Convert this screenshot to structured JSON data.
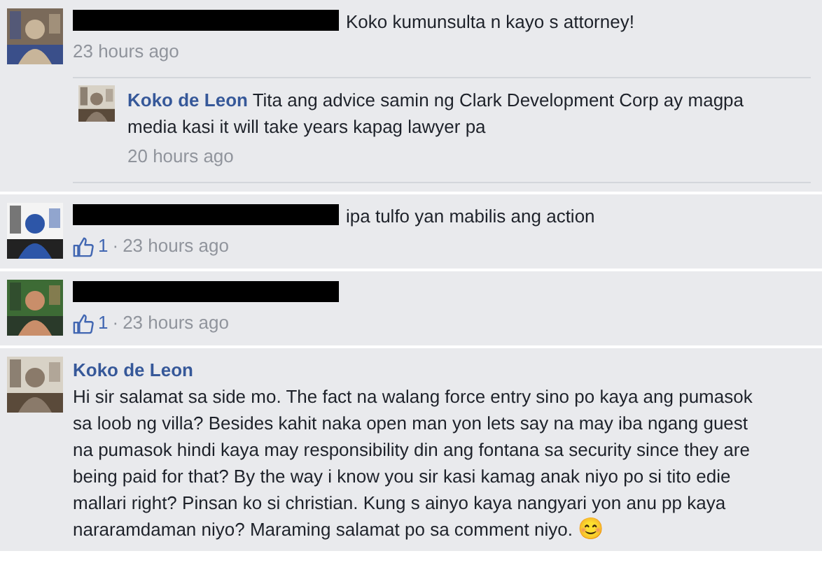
{
  "comments": [
    {
      "redacted": true,
      "text": "Koko kumunsulta n kayo s attorney!",
      "time": "23 hours ago",
      "replies": [
        {
          "author": "Koko de Leon",
          "text": "Tita ang advice samin ng Clark Development Corp ay magpa media kasi it will take years kapag lawyer pa",
          "time": "20 hours ago"
        }
      ]
    },
    {
      "redacted": true,
      "text": "ipa tulfo yan mabilis ang action",
      "likes": "1",
      "separator": "·",
      "time": "23 hours ago"
    },
    {
      "redacted": true,
      "likes": "1",
      "separator": "·",
      "time": "23 hours ago"
    },
    {
      "author": "Koko de Leon",
      "text": "Hi sir salamat sa side mo. The fact na walang force entry sino po kaya ang pumasok sa loob ng villa? Besides kahit naka open man yon lets say na may iba ngang guest na pumasok hindi kaya may responsibility din ang fontana sa security since they are being paid for that? By the way i know you sir kasi kamag anak niyo po si tito edie mallari right? Pinsan ko si christian. Kung s ainyo kaya nangyari yon anu pp kaya nararamdaman niyo? Maraming salamat po sa comment niyo.",
      "emoji": "😊"
    }
  ]
}
